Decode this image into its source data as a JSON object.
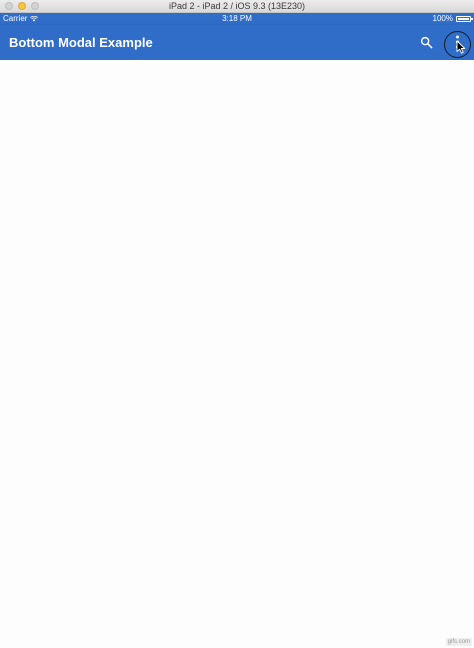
{
  "window": {
    "title": "iPad 2 - iPad 2 / iOS 9.3 (13E230)"
  },
  "status_bar": {
    "carrier": "Carrier",
    "time": "3:18 PM",
    "battery": "100%"
  },
  "app_bar": {
    "title": "Bottom Modal Example",
    "icons": {
      "search": "search-icon",
      "more": "more-vert-icon"
    }
  },
  "watermark": "gifs.com",
  "colors": {
    "primary": "#2f6dc8",
    "background": "#fdfdfd",
    "on_primary": "#ffffff"
  }
}
